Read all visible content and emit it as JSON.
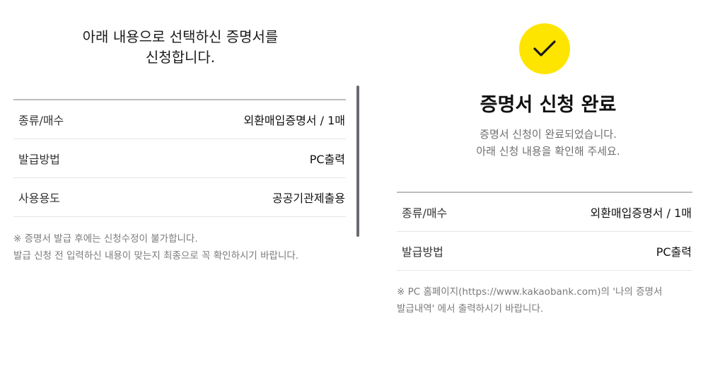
{
  "left": {
    "confirm_line1": "아래 내용으로 선택하신 증명서를",
    "confirm_line2": "신청합니다.",
    "rows": [
      {
        "label": "종류/매수",
        "value": "외환매입증명서 / 1매"
      },
      {
        "label": "발급방법",
        "value": "PC출력"
      },
      {
        "label": "사용용도",
        "value": "공공기관제출용"
      }
    ],
    "notice_line1": "※ 증명서 발급 후에는 신청수정이 불가합니다.",
    "notice_line2": "발급 신청 전 입력하신 내용이 맞는지 최종으로 꼭 확인하시기 바랍니다."
  },
  "right": {
    "icon": "check-icon",
    "icon_bg_color": "#FEE500",
    "title": "증명서 신청 완료",
    "desc_line1": "증명서 신청이 완료되었습니다.",
    "desc_line2": "아래 신청 내용을 확인해 주세요.",
    "rows": [
      {
        "label": "종류/매수",
        "value": "외환매입증명서 / 1매"
      },
      {
        "label": "발급방법",
        "value": "PC출력"
      }
    ],
    "notice_line1": "※ PC 홈페이지(https://www.kakaobank.com)의 '나의 증명서",
    "notice_line2": "발급내역' 에서 출력하시기 바랍니다."
  }
}
